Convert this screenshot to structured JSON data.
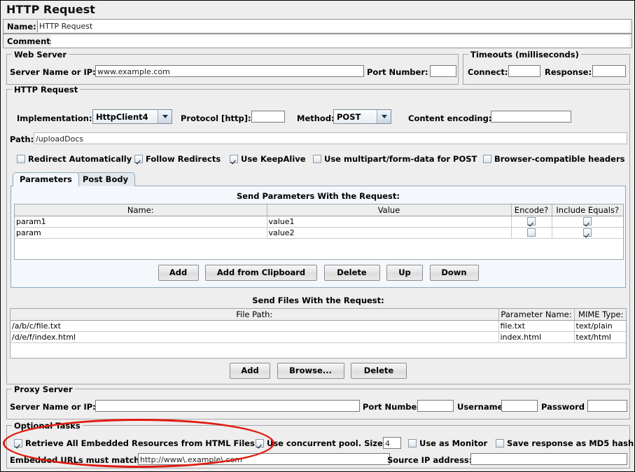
{
  "window": {
    "title": "HTTP Request"
  },
  "top": {
    "name_label": "Name:",
    "name_value": "HTTP Request",
    "comments_label": "Comments:",
    "comments_value": ""
  },
  "web_server": {
    "title": "Web Server",
    "server_label": "Server Name or IP:",
    "server_value": "www.example.com",
    "port_label": "Port Number:",
    "port_value": ""
  },
  "timeouts": {
    "title": "Timeouts (milliseconds)",
    "connect_label": "Connect:",
    "connect_value": "",
    "response_label": "Response:",
    "response_value": ""
  },
  "http_request": {
    "title": "HTTP Request",
    "implementation_label": "Implementation:",
    "implementation_value": "HttpClient4",
    "protocol_label": "Protocol [http]:",
    "protocol_value": "",
    "method_label": "Method:",
    "method_value": "POST",
    "content_encoding_label": "Content encoding:",
    "content_encoding_value": "",
    "path_label": "Path:",
    "path_value": "/uploadDocs",
    "checkboxes": [
      {
        "label": "Redirect Automatically",
        "checked": false
      },
      {
        "label": "Follow Redirects",
        "checked": true
      },
      {
        "label": "Use KeepAlive",
        "checked": true
      },
      {
        "label": "Use multipart/form-data for POST",
        "checked": false
      },
      {
        "label": "Browser-compatible headers",
        "checked": false
      }
    ]
  },
  "tabs": [
    {
      "label": "Parameters",
      "selected": true
    },
    {
      "label": "Post Body",
      "selected": false
    }
  ],
  "parameters": {
    "heading": "Send Parameters With the Request:",
    "columns": [
      "Name:",
      "Value",
      "Encode?",
      "Include Equals?"
    ],
    "rows": [
      {
        "name": "param1",
        "value": "value1",
        "encode": true,
        "include_equals": true
      },
      {
        "name": "param",
        "value": "value2",
        "encode": false,
        "include_equals": true
      }
    ],
    "buttons": [
      "Add",
      "Add from Clipboard",
      "Delete",
      "Up",
      "Down"
    ]
  },
  "files": {
    "heading": "Send Files With the Request:",
    "columns": [
      "File Path:",
      "Parameter Name:",
      "MIME Type:"
    ],
    "rows": [
      {
        "path": "/a/b/c/file.txt",
        "param_name": "file.txt",
        "mime": "text/plain"
      },
      {
        "path": "/d/e/f/index.html",
        "param_name": "index.html",
        "mime": "text/html"
      }
    ],
    "buttons": [
      "Add",
      "Browse...",
      "Delete"
    ]
  },
  "proxy": {
    "title": "Proxy Server",
    "server_label": "Server Name or IP:",
    "server_value": "",
    "port_label": "Port Number:",
    "port_value": "",
    "username_label": "Username",
    "username_value": "",
    "password_label": "Password",
    "password_value": ""
  },
  "optional": {
    "title": "Optional Tasks",
    "retrieve_label": "Retrieve All Embedded Resources from HTML Files",
    "retrieve_checked": true,
    "concurrent_label": "Use concurrent pool. Size:",
    "concurrent_checked": true,
    "concurrent_size": "4",
    "monitor_label": "Use as Monitor",
    "monitor_checked": false,
    "md5_label": "Save response as MD5 hash",
    "md5_checked": false,
    "embedded_label": "Embedded URLs must match:",
    "embedded_value": "http://www\\.example\\.com",
    "source_ip_label": "Source IP address:",
    "source_ip_value": ""
  },
  "annotation": {
    "shape": "ellipse",
    "color": "#e01b10"
  }
}
